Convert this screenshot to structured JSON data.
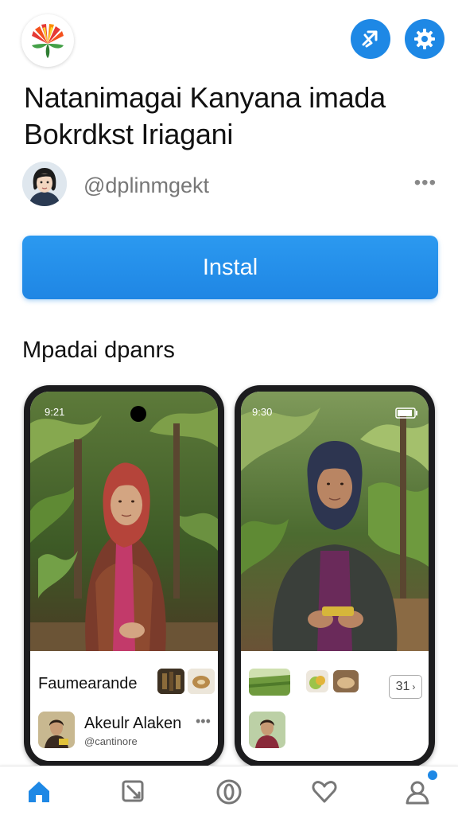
{
  "app": {
    "title_line1": "Natanimagai Kanyana imada",
    "title_line2": "Bokrdkst Iriagani"
  },
  "author": {
    "handle": "@dplinmgekt",
    "more_label": "•••"
  },
  "install_button": {
    "label": "Instal"
  },
  "screenshots": {
    "section_title": "Mpadai dpanrs",
    "phone1": {
      "time": "9:21",
      "card_title": "Faumearande",
      "user_name": "Akeulr Alaken",
      "user_sub": "@cantinore",
      "user_more": "•••"
    },
    "phone2": {
      "time": "9:30",
      "counter": "31"
    }
  },
  "icons": {
    "logo": "leaf-fan-logo",
    "share": "share-icon",
    "settings": "gear-icon",
    "nav": [
      "home-icon",
      "tag-icon",
      "discover-icon",
      "heart-icon",
      "profile-icon"
    ]
  },
  "colors": {
    "accent": "#1e88e5",
    "install": "#2b99f0"
  }
}
